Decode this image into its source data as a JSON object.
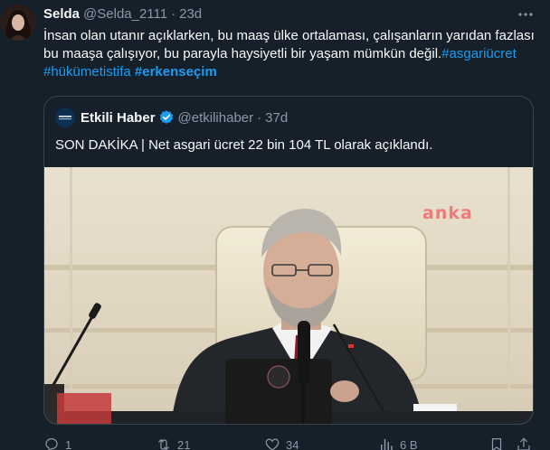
{
  "author": {
    "name": "Selda",
    "handle": "@Selda_2111",
    "separator": "·",
    "time": "23d"
  },
  "tweet": {
    "text_plain": "İnsan olan utanır açıklarken, bu maaş ülke ortalaması, çalışanların yarıdan fazlası bu maaşa çalışıyor, bu parayla haysiyetli bir yaşam mümkün değil.",
    "hashtags": [
      "#asgariücret",
      "#hükümetistifa",
      "#erkenseçim"
    ]
  },
  "quote": {
    "avatar_text": "ETKİLİ HABER",
    "name": "Etkili Haber",
    "handle": "@etkilihaber",
    "separator": "·",
    "time": "37d",
    "text": "SON DAKİKA | Net asgari ücret 22 bin 104 TL olarak açıklandı.",
    "watermark": "anka"
  },
  "actions": {
    "reply_count": "1",
    "retweet_count": "21",
    "like_count": "34",
    "views_count": "6 B"
  },
  "colors": {
    "background": "#15202b",
    "text": "#f7f9f9",
    "secondary": "#8b98a5",
    "link": "#1d9bf0",
    "border": "#38444d"
  }
}
